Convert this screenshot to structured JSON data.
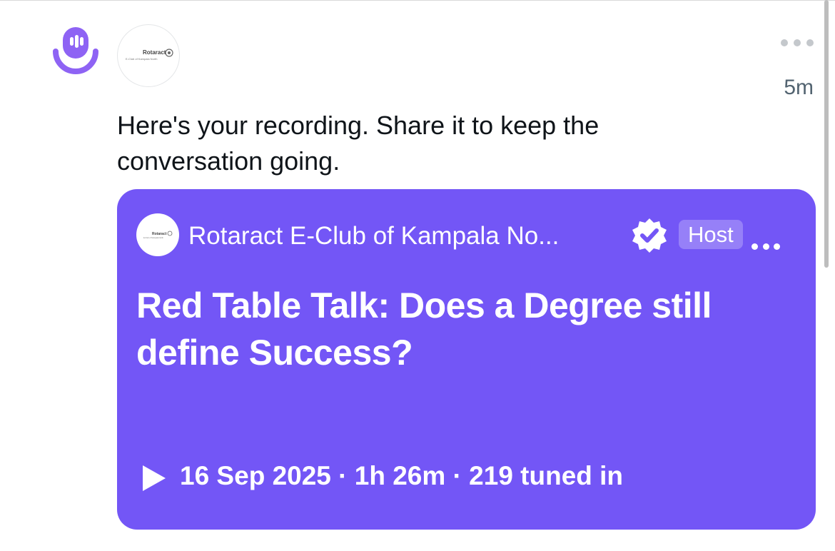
{
  "post": {
    "timestamp": "5m",
    "message": "Here's your recording. Share it to keep the conversation going.",
    "avatar_logo": {
      "name": "Rotaract",
      "subtitle": "E-Club of Kampala North"
    },
    "icons": {
      "app": "spaces-microphone-icon",
      "more": "more-horizontal-icon"
    }
  },
  "space_card": {
    "background": "#7356f6",
    "host_name": "Rotaract E-Club of Kampala No...",
    "host_badge": "Host",
    "title": "Red Table Talk: Does a Degree still define Success?",
    "meta": "16 Sep 2025 · 1h 26m · 219 tuned in",
    "icons": {
      "verified": "verified-badge-icon",
      "play": "play-icon"
    }
  }
}
